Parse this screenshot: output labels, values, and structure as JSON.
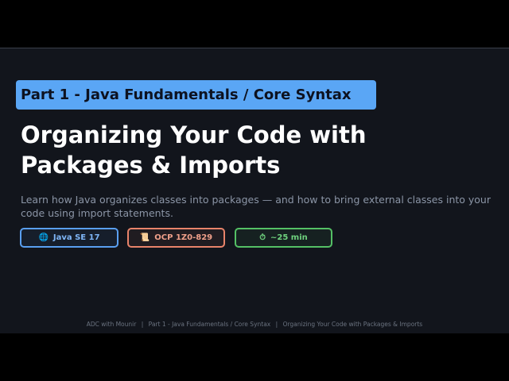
{
  "section_tag": "Part 1 - Java Fundamentals / Core Syntax",
  "title_line1": "Organizing Your Code with",
  "title_line2": "Packages & Imports",
  "subtitle": "Learn how Java organizes classes into packages — and how to bring external classes into your code using import statements.",
  "badges": [
    {
      "icon": "globe-icon",
      "glyph": "🌐",
      "label": "Java SE 17",
      "color": "#5a9ff0"
    },
    {
      "icon": "scroll-icon",
      "glyph": "📜",
      "label": "OCP 1Z0-829",
      "color": "#e8836a"
    },
    {
      "icon": "timer-icon",
      "glyph": "⏱",
      "label": "~25 min",
      "color": "#54c065"
    }
  ],
  "footer": {
    "channel": "ADC with Mounir",
    "separator": "|",
    "part": "Part 1 - Java Fundamentals / Core Syntax",
    "lesson": "Organizing Your Code with Packages & Imports"
  },
  "colors": {
    "background": "#12151c",
    "section_tag_bg": "#5aa6f5",
    "title": "#ffffff",
    "subtitle": "#8b95a6"
  }
}
